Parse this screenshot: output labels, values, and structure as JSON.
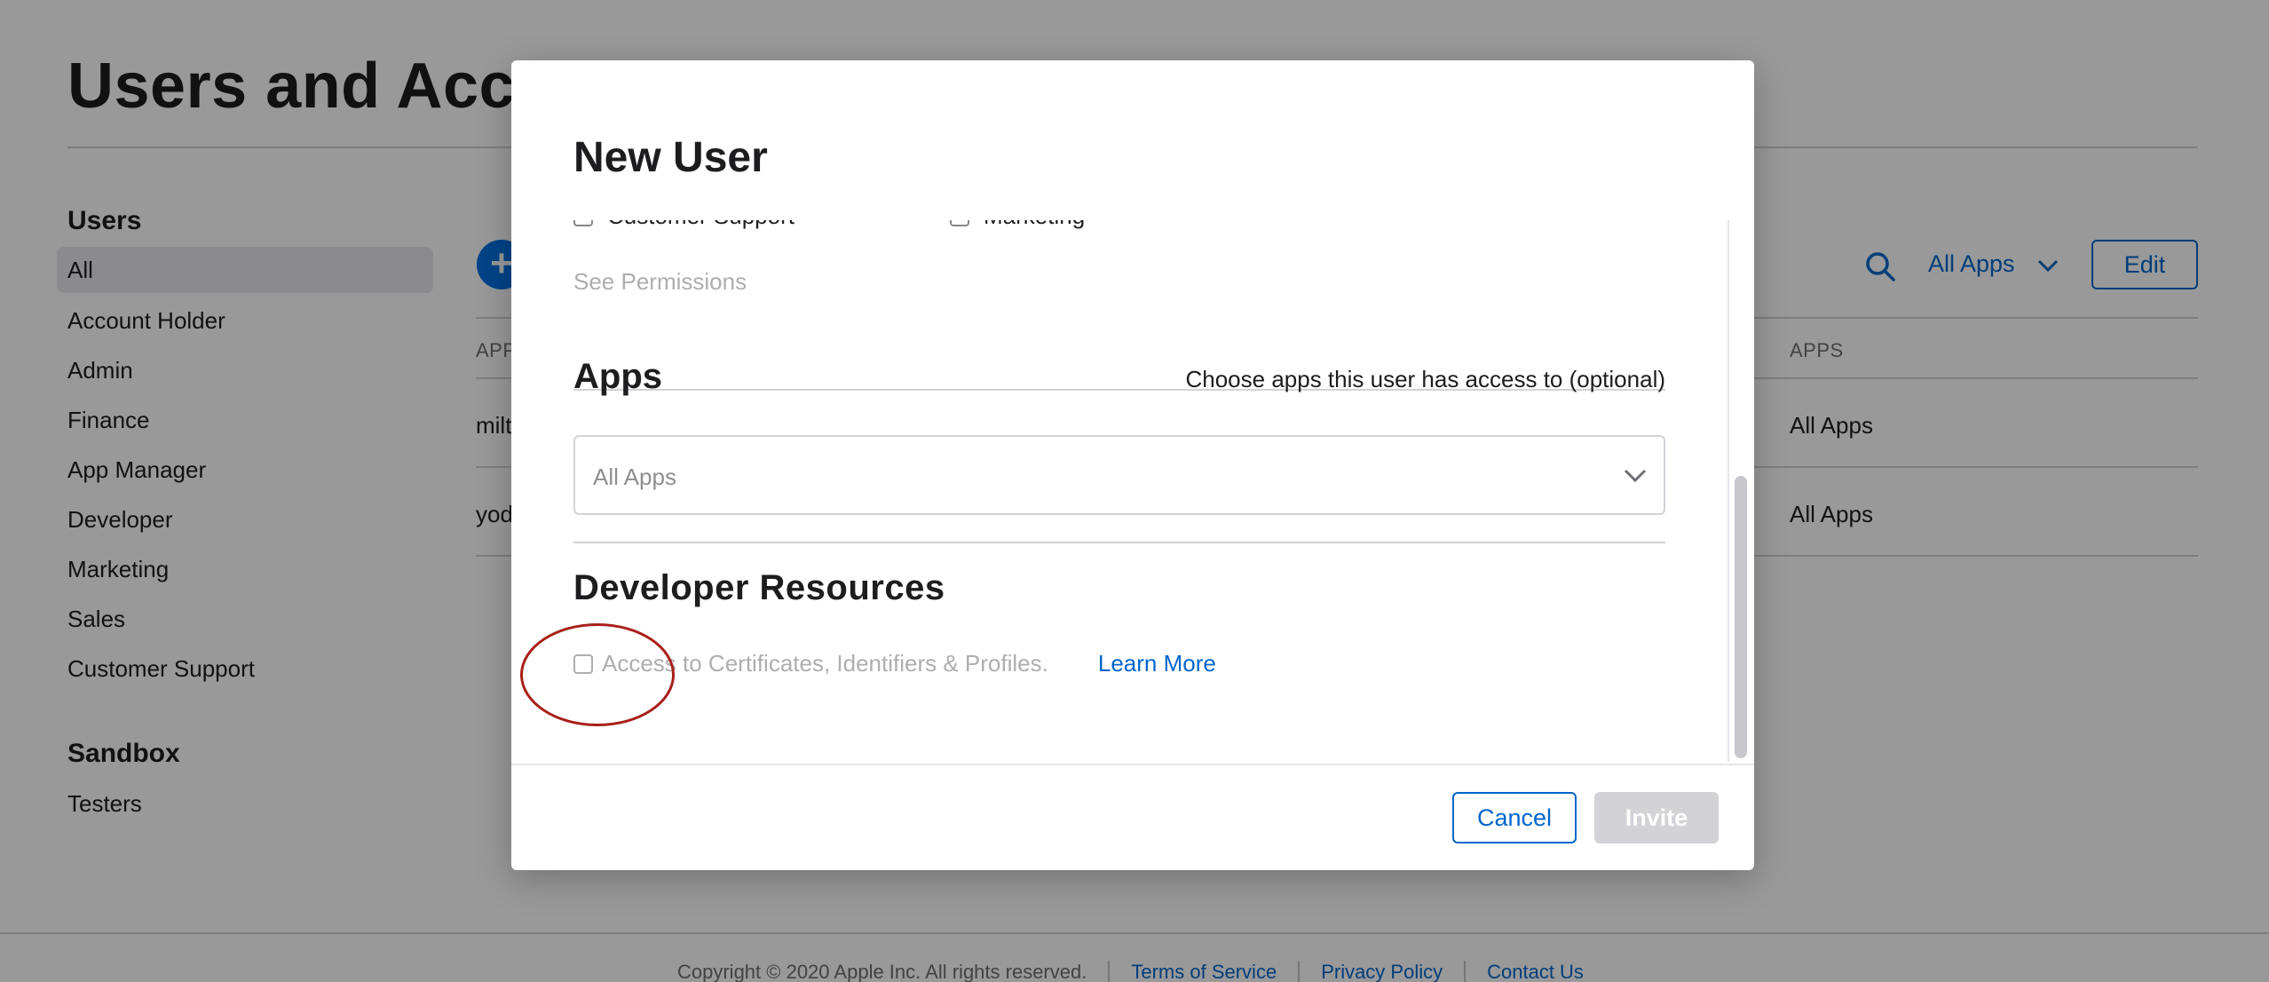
{
  "page": {
    "title": "Users and Acce",
    "sidebar": {
      "users_heading": "Users",
      "items": [
        "All",
        "Account Holder",
        "Admin",
        "Finance",
        "App Manager",
        "Developer",
        "Marketing",
        "Sales",
        "Customer Support"
      ],
      "sandbox_heading": "Sandbox",
      "sandbox_items": [
        "Testers"
      ]
    },
    "toolbar": {
      "add_label": "+",
      "filter_label": "All Apps",
      "edit_label": "Edit"
    },
    "table": {
      "col_left": "APP",
      "col_apps": "APPS",
      "rows": [
        {
          "name": "milt",
          "apps": "All Apps"
        },
        {
          "name": "yod",
          "apps": "All Apps"
        }
      ]
    },
    "footer": {
      "copyright": "Copyright © 2020 Apple Inc. All rights reserved.",
      "terms": "Terms of Service",
      "privacy": "Privacy Policy",
      "contact": "Contact Us"
    }
  },
  "modal": {
    "title": "New User",
    "roles_partial": [
      "Customer Support",
      "Marketing"
    ],
    "see_permissions": "See Permissions",
    "apps": {
      "heading": "Apps",
      "hint": "Choose apps this user has access to (optional)",
      "select_placeholder": "All Apps"
    },
    "developer_resources": {
      "heading": "Developer Resources",
      "checkbox_label": "Access to Certificates, Identifiers & Profiles.",
      "learn_more": "Learn More"
    },
    "buttons": {
      "cancel": "Cancel",
      "invite": "Invite"
    }
  },
  "colors": {
    "accent": "#0066cc",
    "annotation": "#a8201a",
    "disabled_button": "#d2d2d7"
  }
}
